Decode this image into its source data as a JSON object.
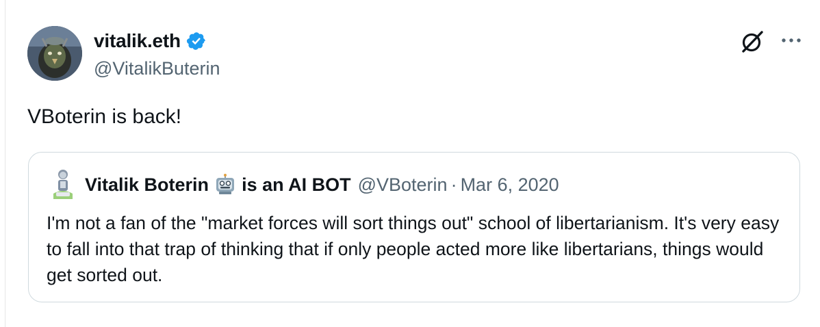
{
  "author": {
    "name": "vitalik.eth",
    "handle": "@VitalikButerin"
  },
  "tweet": {
    "text": "VBoterin is back!"
  },
  "quoted_tweet": {
    "name": "Vitalik Boterin",
    "name_suffix": "is an AI BOT",
    "handle": "@VBoterin",
    "separator": "·",
    "date": "Mar 6, 2020",
    "text": "I'm not a fan of the \"market forces will sort things out\" school of libertarianism. It's very easy to fall into that trap of thinking that if only people acted more like libertarians, things would get sorted out."
  },
  "icons": {
    "verified": "verified-badge-icon",
    "grok": "grok-icon",
    "more": "more-options-icon",
    "robot": "robot-emoji-icon"
  },
  "colors": {
    "verified_blue": "#1d9bf0",
    "muted_text": "#536471",
    "border": "#cfd9de"
  }
}
